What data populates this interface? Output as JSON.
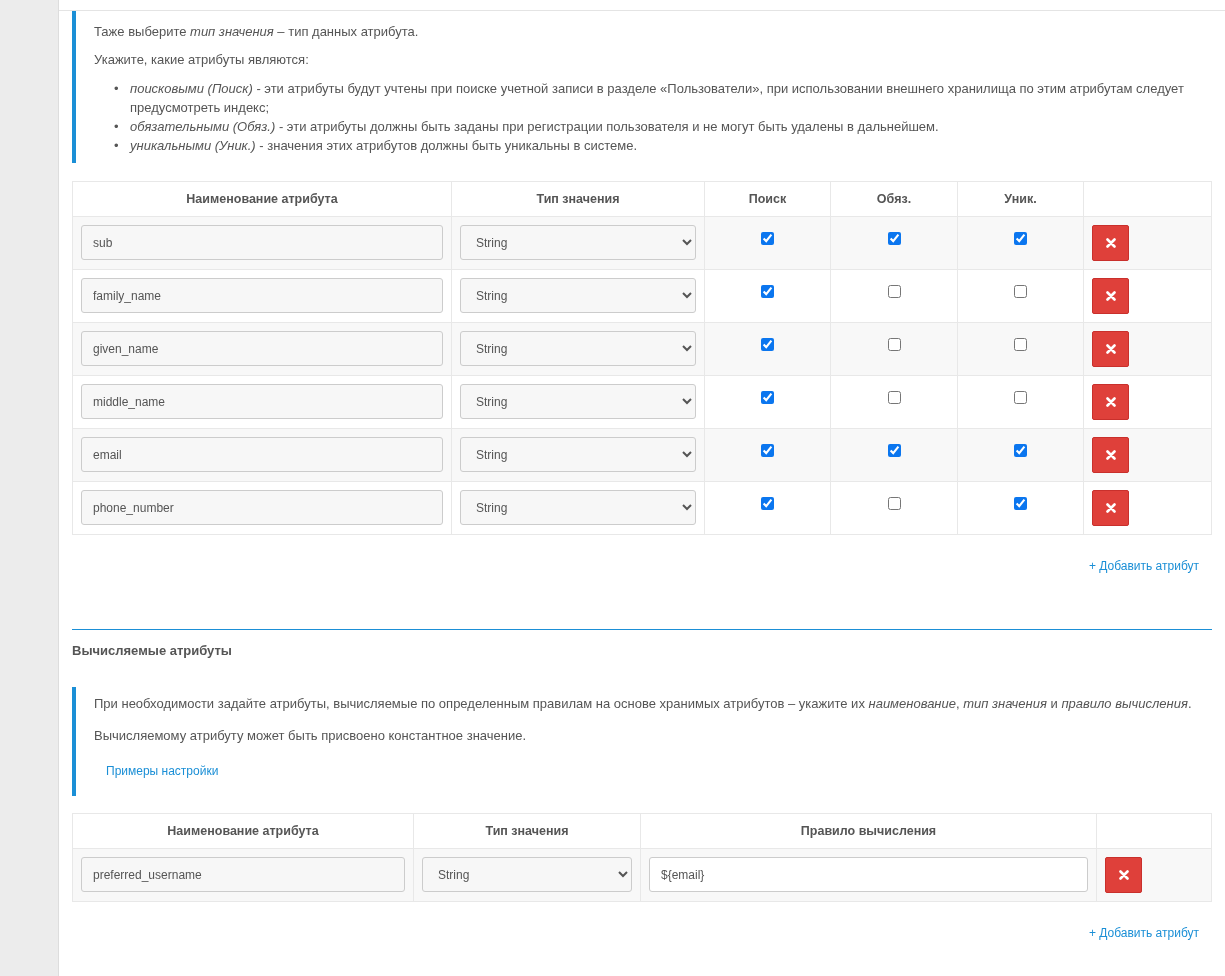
{
  "stored_info": {
    "paragraphs": [
      "Таже выберите *тип значения* – тип данных атрибута.",
      "Укажите, какие атрибуты являются:"
    ],
    "list_items": [
      {
        "marker": "•",
        "text": "*поисковыми (Поиск)* - эти атрибуты будут учтены при поиске учетной записи в разделе «Пользователи», при использовании внешнего хранилища по этим атрибутам следует предусмотреть индекс;"
      },
      {
        "marker": "•",
        "text": "*обязательными (Обяз.)* - эти атрибуты должны быть заданы при регистрации пользователя и не могут быть удалены в дальнейшем."
      },
      {
        "marker": "•",
        "text": "*уникальными (Уник.)* - значения этих атрибутов должны быть уникальны в системе."
      }
    ]
  },
  "stored_table": {
    "columns": [
      "Наименование атрибута",
      "Тип значения",
      "Поиск",
      "Обяз.",
      "Уник."
    ],
    "rows": [
      {
        "name": "sub",
        "type": "String",
        "search": true,
        "required": true,
        "unique": true
      },
      {
        "name": "family_name",
        "type": "String",
        "search": true,
        "required": false,
        "unique": false
      },
      {
        "name": "given_name",
        "type": "String",
        "search": true,
        "required": false,
        "unique": false
      },
      {
        "name": "middle_name",
        "type": "String",
        "search": true,
        "required": false,
        "unique": false
      },
      {
        "name": "email",
        "type": "String",
        "search": true,
        "required": true,
        "unique": true
      },
      {
        "name": "phone_number",
        "type": "String",
        "search": true,
        "required": false,
        "unique": true
      }
    ],
    "add_link": "+ Добавить атрибут"
  },
  "computed_section": {
    "title": "Вычисляемые атрибуты",
    "info": {
      "paragraphs": [
        "При необходимости задайте атрибуты, вычисляемые по определенным правилам на основе хранимых атрибутов – укажите их *наименование*, *тип значения* и *правило вычисления*.",
        "Вычисляемому атрибуту может быть присвоено константное значение."
      ],
      "link": "Примеры настройки"
    },
    "table": {
      "columns": [
        "Наименование атрибута",
        "Тип значения",
        "Правило вычисления"
      ],
      "rows": [
        {
          "name": "preferred_username",
          "type": "String",
          "rule": "${email}"
        }
      ]
    },
    "add_link": "+ Добавить атрибут"
  }
}
